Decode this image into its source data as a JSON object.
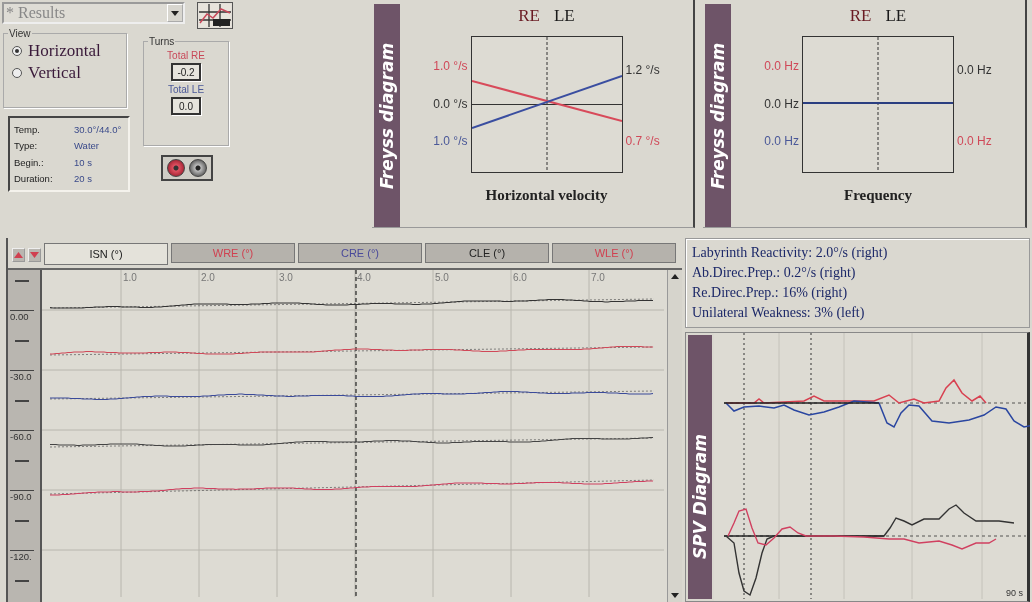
{
  "results_dropdown": {
    "value": "* Results"
  },
  "view": {
    "title": "View",
    "options": [
      {
        "label": "Horizontal",
        "selected": true
      },
      {
        "label": "Vertical",
        "selected": false
      }
    ]
  },
  "turns": {
    "title": "Turns",
    "fields": [
      {
        "label": "Total RE",
        "value": "-0.2",
        "color": "#c84858"
      },
      {
        "label": "Total LE",
        "value": "0.0",
        "color": "#4a5898"
      }
    ]
  },
  "info": [
    {
      "label": "Temp.",
      "value": "30.0°/44.0°"
    },
    {
      "label": "Type:",
      "value": "Water"
    },
    {
      "label": "Begin.:",
      "value": "10 s"
    },
    {
      "label": "Duration:",
      "value": "20 s"
    }
  ],
  "freyss": [
    {
      "kind": "velocity",
      "side_title": "Freyss diagram",
      "header": [
        {
          "text": "RE",
          "color": "#6a1a22"
        },
        {
          "text": "LE",
          "color": "#1a1a1a"
        }
      ],
      "left_labels": [
        {
          "text": "1.0 °/s",
          "color": "#d04858"
        },
        {
          "text": "0.0 °/s",
          "color": "#333333"
        },
        {
          "text": "1.0 °/s",
          "color": "#4a5898"
        }
      ],
      "right_labels": [
        {
          "text": "1.2 °/s",
          "color": "#333333"
        },
        {
          "text": "0.7 °/s",
          "color": "#d04858"
        }
      ],
      "footer": "Horizontal velocity"
    },
    {
      "kind": "frequency",
      "side_title": "Freyss diagram",
      "header": [
        {
          "text": "RE",
          "color": "#6a1a22"
        },
        {
          "text": "LE",
          "color": "#1a1a1a"
        }
      ],
      "left_labels": [
        {
          "text": "0.0 Hz",
          "color": "#d04858"
        },
        {
          "text": "0.0 Hz",
          "color": "#333333"
        },
        {
          "text": "0.0 Hz",
          "color": "#4a5898"
        }
      ],
      "right_labels": [
        {
          "text": "0.0 Hz",
          "color": "#333333"
        },
        {
          "text": "0.0 Hz",
          "color": "#d04858"
        }
      ],
      "footer": "Frequency"
    }
  ],
  "traces": {
    "tabs": [
      {
        "label": "ISN (°)",
        "selected": true,
        "color": "#222222"
      },
      {
        "label": "WRE (°)",
        "selected": false,
        "color": "#d04050"
      },
      {
        "label": "CRE (°)",
        "selected": false,
        "color": "#4a4a9a"
      },
      {
        "label": "CLE (°)",
        "selected": false,
        "color": "#222222"
      },
      {
        "label": "WLE (°)",
        "selected": false,
        "color": "#d04050"
      }
    ],
    "x_labels": [
      "1.0",
      "2.0",
      "3.0",
      "4.0",
      "5.0",
      "6.0",
      "7.0"
    ],
    "y_labels": [
      "0.00",
      "-30.0",
      "-60.0",
      "-90.0",
      "-120."
    ]
  },
  "results": [
    "Labyrinth Reactivity: 2.0°/s (right)",
    "Ab.Direc.Prep.: 0.2°/s (right)",
    "Re.Direc.Prep.: 16% (right)",
    "Unilateral Weakness: 3% (left)"
  ],
  "spv": {
    "side_title": "SPV Diagram",
    "time_label": "90 s"
  }
}
